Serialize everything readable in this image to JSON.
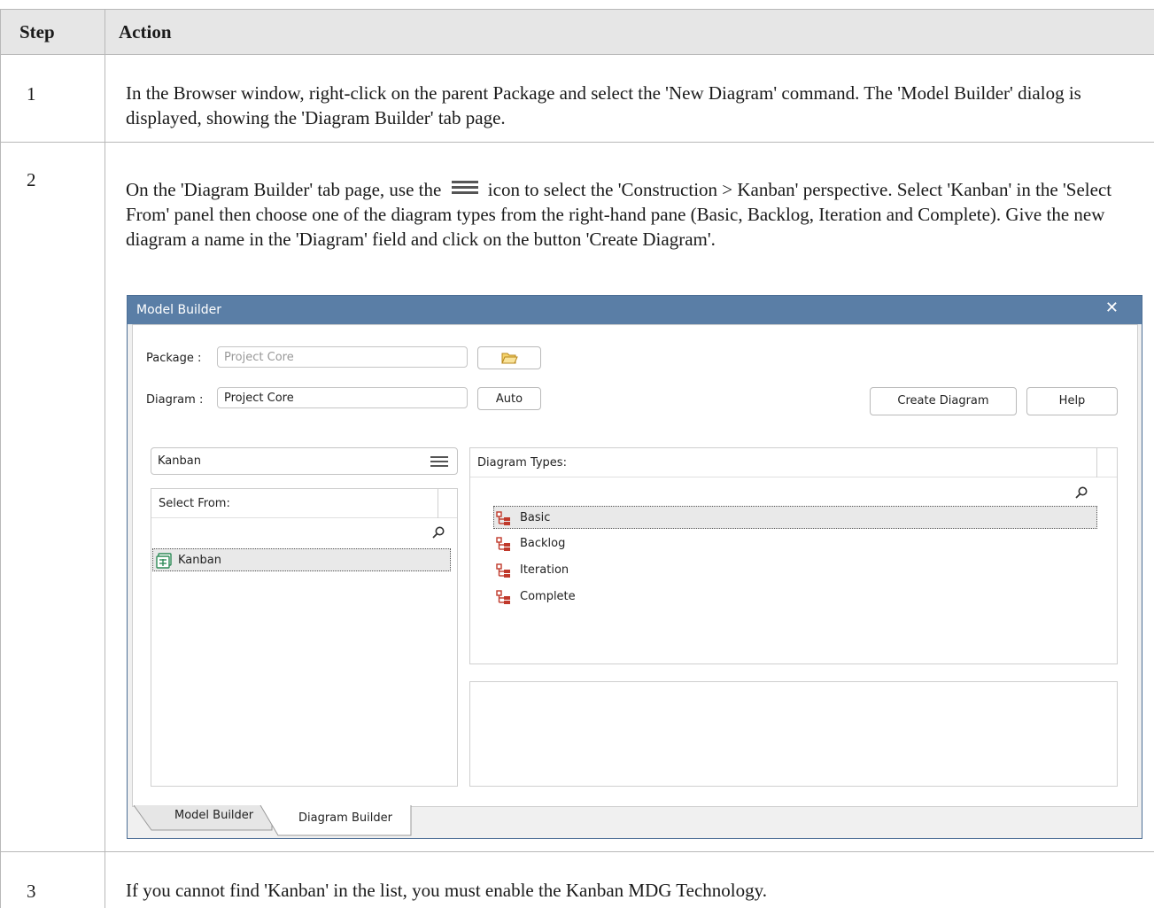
{
  "table": {
    "headers": {
      "step": "Step",
      "action": "Action"
    },
    "rows": [
      {
        "step": "1",
        "action": "In the Browser window, right-click on the parent Package and select the 'New Diagram' command.  The 'Model Builder' dialog is displayed, showing the 'Diagram Builder' tab page."
      },
      {
        "step": "2",
        "action_before_icon": "On the 'Diagram Builder' tab page, use the",
        "action_after_icon": "icon to select the 'Construction > Kanban' perspective. Select 'Kanban' in the 'Select From' panel then choose one of the diagram types from the right-hand pane (Basic, Backlog, Iteration and Complete). Give the new diagram a name in the 'Diagram' field and click on the button 'Create Diagram'.",
        "icon": "hamburger-menu-icon"
      },
      {
        "step": "3",
        "action": "If you cannot find 'Kanban' in the list, you must enable the Kanban MDG Technology."
      }
    ]
  },
  "dialog": {
    "title": "Model Builder",
    "close_icon": "close-icon",
    "package_label": "Package :",
    "package_value": "Project Core",
    "folder_icon": "open-folder-icon",
    "diagram_label": "Diagram :",
    "diagram_value": "Project Core",
    "auto_button": "Auto",
    "create_button": "Create Diagram",
    "help_button": "Help",
    "perspective_value": "Kanban",
    "select_from_header": "Select From:",
    "select_from_items": [
      "Kanban"
    ],
    "diagram_types_header": "Diagram Types:",
    "diagram_types": [
      "Basic",
      "Backlog",
      "Iteration",
      "Complete"
    ],
    "tabs": [
      "Model Builder",
      "Diagram Builder"
    ],
    "active_tab": "Diagram Builder"
  },
  "colors": {
    "title_bar": "#5a7ea6",
    "header_bg": "#e6e6e6",
    "border": "#b8b8b8",
    "tree_icon": "#c0392b",
    "kanban_icon": "#2e8b57"
  }
}
